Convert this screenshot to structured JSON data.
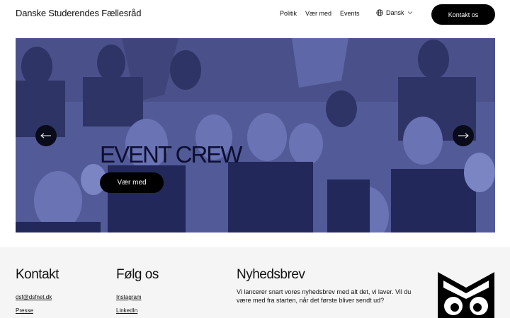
{
  "header": {
    "brand": "Danske Studerendes Fællesråd",
    "nav": [
      "Politik",
      "Vær med",
      "Events"
    ],
    "language": "Dansk",
    "cta": "Kontakt os"
  },
  "hero": {
    "title": "EVENT CREW",
    "button": "Vær med",
    "overlay_color": "#4d5590"
  },
  "footer": {
    "contact": {
      "title": "Kontakt",
      "links": [
        "dsf@dsfnet.dk",
        "Presse"
      ]
    },
    "follow": {
      "title": "Følg os",
      "links": [
        "Instagram",
        "LinkedIn"
      ]
    },
    "newsletter": {
      "title": "Nyhedsbrev",
      "text": "Vi lancerer snart vores nyhedsbrev med alt det, vi laver. Vil du være med fra starten, når det første bliver sendt ud?"
    }
  },
  "icons": [
    "globe-icon",
    "chevron-down-icon",
    "arrow-left-icon",
    "arrow-right-icon",
    "owl-logo-icon"
  ]
}
